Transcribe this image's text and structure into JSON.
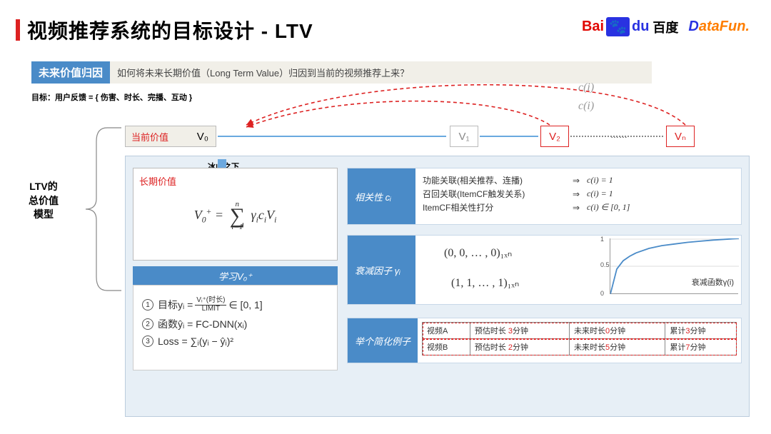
{
  "title": "视频推荐系统的目标设计 - LTV",
  "logos": {
    "baidu_bai": "Bai",
    "baidu_du": "du",
    "baidu_cn": "百度",
    "datafun": "DataFun."
  },
  "tag": "未来价值归因",
  "sub_q": "如何将未来长期价值（Long Term Value）归因到当前的视频推荐上来？",
  "goal": "目标：用户反馈 = { 伤害、时长、完播、互动 }",
  "ltv_label_l1": "LTV的",
  "ltv_label_l2": "总价值",
  "ltv_label_l3": "模型",
  "seq": {
    "current": "当前价值",
    "v0": "V₀",
    "v1": "V₁",
    "v2": "V₂",
    "dots": "……",
    "vn": "Vₙ"
  },
  "c_i_1": "c(i)",
  "c_i_2": "c(i)",
  "iceberg": "冰山之下",
  "long_label": "长期价值",
  "formula_sum": "V₀⁺ = ∑ γᵢcᵢVᵢ",
  "formula_sum_top": "n",
  "formula_sum_bottom": "i=1",
  "learn_title": "学习V₀⁺",
  "learn": {
    "r1a": "目标yᵢ = ",
    "r1_num": "Vᵢ⁺(时长)",
    "r1_den": "LIMIT",
    "r1b": " ∈ [0, 1]",
    "r2": "函数ŷᵢ = FC-DNN(xᵢ)",
    "r3": "Loss   = ∑ᵢ(yᵢ − ŷᵢ)²"
  },
  "rel": {
    "head": "相关性 cᵢ",
    "row1": {
      "t": "功能关联(相关推荐、连播)",
      "r": "c(i) = 1"
    },
    "row2": {
      "t": "召回关联(ItemCF触发关系)",
      "r": "c(i) = 1"
    },
    "row3": {
      "t": "ItemCF相关性打分",
      "r": "c(i) ∈ [0, 1]"
    }
  },
  "decay": {
    "head": "衰减因子 γᵢ",
    "zeros": "(0, 0, … , 0)₁ₓₙ",
    "ones": "(1, 1, … , 1)₁ₓₙ",
    "fn": "衰减函数γ(i)",
    "ticks": {
      "t1": "1",
      "t05": "0.5",
      "t0": "0"
    }
  },
  "example": {
    "head": "举个简化例子",
    "rows": [
      {
        "a": "视频A",
        "b": "预估时长 3分钟",
        "c": "未来时长0分钟",
        "d": "累计3分钟"
      },
      {
        "a": "视频B",
        "b": "预估时长 2分钟",
        "c": "未来时长5分钟",
        "d": "累计7分钟"
      }
    ]
  },
  "chart_data": {
    "type": "line",
    "title": "衰减函数γ(i)",
    "ylim": [
      0,
      1
    ],
    "yticks": [
      0,
      0.5,
      1
    ],
    "x": [
      0,
      0.05,
      0.1,
      0.15,
      0.2,
      0.3,
      0.4,
      0.5,
      0.6,
      0.7,
      0.8,
      0.9,
      1.0
    ],
    "values": [
      0,
      0.45,
      0.6,
      0.68,
      0.74,
      0.82,
      0.87,
      0.9,
      0.93,
      0.95,
      0.97,
      0.985,
      1.0
    ]
  }
}
